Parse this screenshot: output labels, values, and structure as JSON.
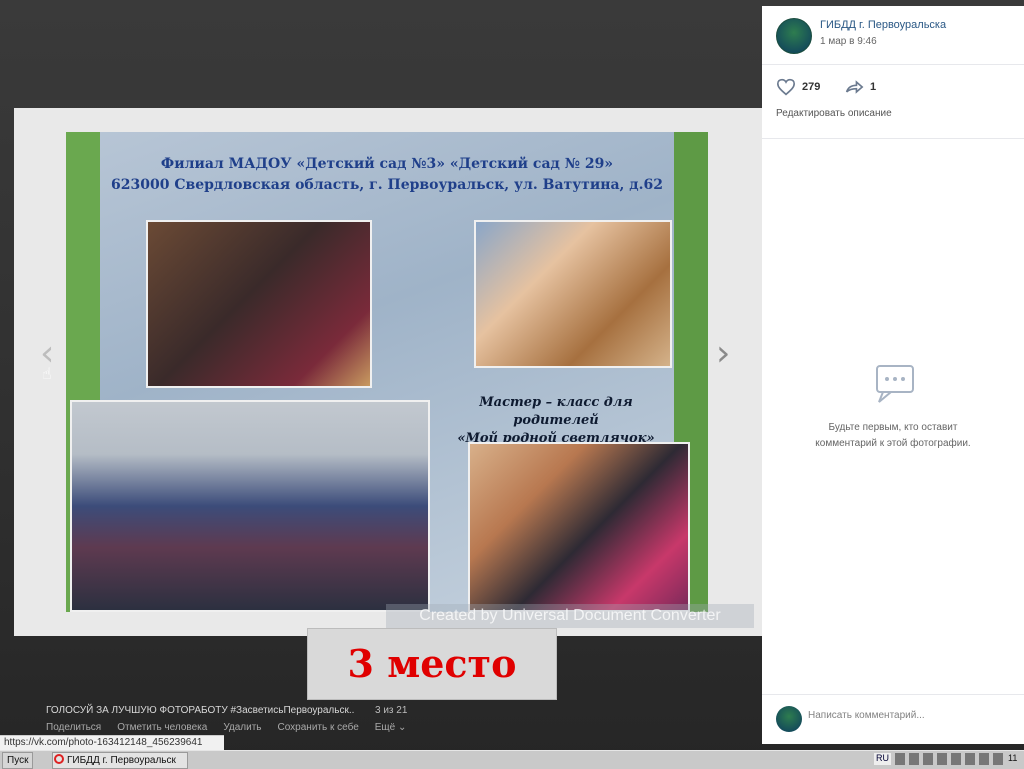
{
  "group": {
    "name": "ГИБДД г. Первоуральска",
    "date": "1 мар в 9:46"
  },
  "stats": {
    "likes": "279",
    "shares": "1"
  },
  "sidebar": {
    "edit_description": "Редактировать описание",
    "empty_comments": "Будьте первым, кто оставит комментарий к этой фотографии.",
    "comment_placeholder": "Написать комментарий..."
  },
  "slide": {
    "header_line1": "Филиал МАДОУ «Детский сад №3» «Детский сад № 29»",
    "header_line2": "623000 Свердловская область, г. Первоуральск, ул. Ватутина, д.62",
    "caption_line1": "Мастер – класс для родителей",
    "caption_line2": "«Мой родной светлячок»",
    "watermark": "Created by Universal Document Converter"
  },
  "overlay": {
    "place": "3 место"
  },
  "bottom": {
    "album_title": "ГОЛОСУЙ ЗА ЛУЧШУЮ ФОТОРАБОТУ #ЗасветисьПервоуральск..",
    "counter": "3 из 21",
    "actions": [
      "Поделиться",
      "Отметить человека",
      "Удалить",
      "Сохранить к себе",
      "Ещё ⌄"
    ]
  },
  "status_url": "https://vk.com/photo-163412148_456239641",
  "taskbar": {
    "start": "Пуск",
    "window": "ГИБДД г. Первоуральск",
    "lang": "RU",
    "clock": "11"
  },
  "colors": {
    "link": "#2a5885",
    "place_text": "#e00000",
    "viewer_bg": "#2f2f2f"
  },
  "icons": [
    "heart-icon",
    "share-arrow-icon",
    "comment-bubble-icon",
    "chevron-left-icon",
    "chevron-right-icon",
    "opera-icon"
  ]
}
